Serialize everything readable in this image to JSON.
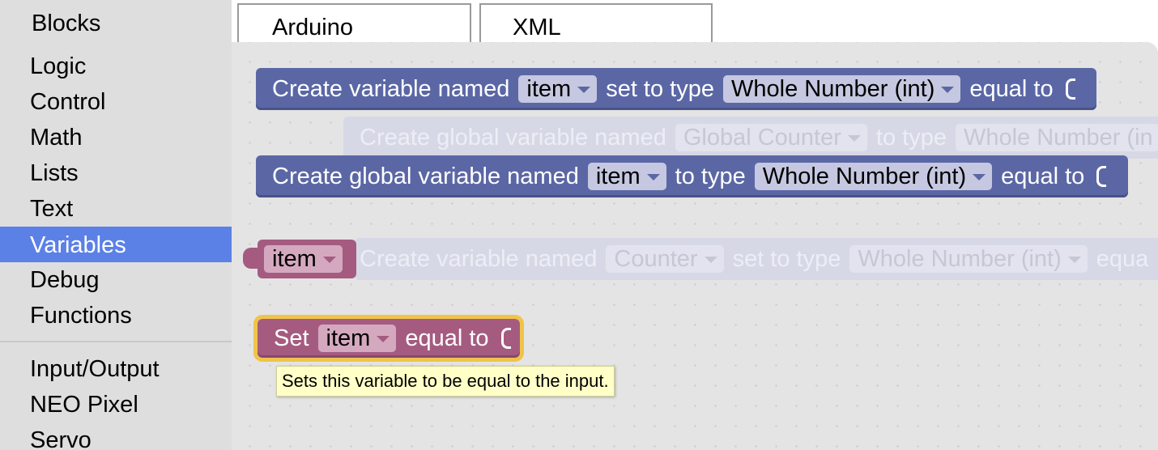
{
  "tabs": {
    "blocks": "Blocks",
    "arduino": "Arduino",
    "xml": "XML"
  },
  "sidebar": {
    "categories": [
      {
        "label": "Logic"
      },
      {
        "label": "Control"
      },
      {
        "label": "Math"
      },
      {
        "label": "Lists"
      },
      {
        "label": "Text"
      },
      {
        "label": "Variables",
        "selected": true
      },
      {
        "label": "Debug"
      },
      {
        "label": "Functions"
      },
      {
        "label": "Input/Output"
      },
      {
        "label": "NEO Pixel"
      },
      {
        "label": "Servo"
      }
    ],
    "selected_color": "#5b80e6"
  },
  "blocks": {
    "create_var": {
      "prefix": "Create variable named",
      "name": "item",
      "mid": "set to type",
      "type": "Whole Number (int)",
      "suffix": "equal to"
    },
    "ghost_global": {
      "prefix": "Create global variable named",
      "name": "Global Counter",
      "mid": "to type",
      "type": "Whole Number (in"
    },
    "create_global": {
      "prefix": "Create global variable named",
      "name": "item",
      "mid": "to type",
      "type": "Whole Number (int)",
      "suffix": "equal to"
    },
    "getter": {
      "name": "item"
    },
    "ghost_var": {
      "prefix": "Create variable named",
      "name": "Counter",
      "mid": "set to type",
      "type": "Whole Number (int)",
      "suffix": "equa"
    },
    "set_var": {
      "prefix": "Set",
      "name": "item",
      "suffix": "equal to"
    }
  },
  "tooltip": "Sets this variable to be equal to the input.",
  "colors": {
    "variable_block": "#5b67a5",
    "set_block": "#a55b80",
    "highlight": "#f0c44a",
    "tooltip_bg": "#ffffc7"
  }
}
